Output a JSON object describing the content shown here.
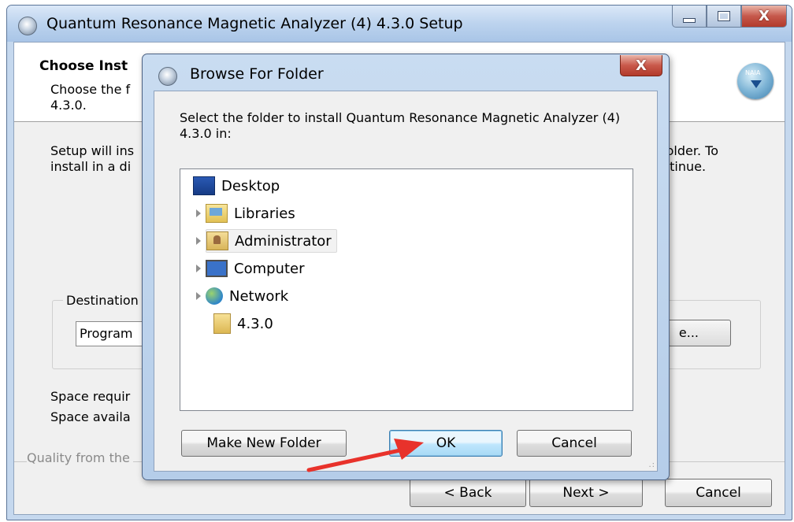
{
  "setup_window": {
    "title": "Quantum Resonance Magnetic Analyzer (4) 4.3.0 Setup",
    "min_glyph": "",
    "close_glyph": "X",
    "header_title": "Choose Inst",
    "header_subtitle": "Choose the f\n4.3.0.",
    "logo_tag": "NAIA",
    "intro_left": "Setup will ins\ninstall in a di",
    "intro_right": "folder. To\nntinue.",
    "destination_label": "Destination",
    "destination_value": "Program",
    "browse_button": "e...",
    "space_required": "Space requir",
    "space_available": "Space availa",
    "branding": "Quality from the",
    "back_button": "< Back",
    "next_button": "Next >",
    "cancel_button": "Cancel"
  },
  "browse_dialog": {
    "title": "Browse For Folder",
    "close_glyph": "X",
    "instruction": "Select the folder to install Quantum Resonance Magnetic Analyzer (4) 4.3.0 in:",
    "tree": [
      {
        "label": "Desktop",
        "icon": "desktop-icon",
        "expandable": false
      },
      {
        "label": "Libraries",
        "icon": "libraries-icon",
        "expandable": true
      },
      {
        "label": "Administrator",
        "icon": "user-folder-icon",
        "expandable": true,
        "selected": true
      },
      {
        "label": "Computer",
        "icon": "computer-icon",
        "expandable": true
      },
      {
        "label": "Network",
        "icon": "network-icon",
        "expandable": true
      },
      {
        "label": "4.3.0",
        "icon": "folder-icon",
        "expandable": false
      }
    ],
    "make_new_folder_button": "Make New Folder",
    "ok_button": "OK",
    "cancel_button": "Cancel"
  },
  "annotation": {
    "arrow_color": "#e8322b"
  },
  "colors": {
    "title_bar": "#bcd3ee",
    "close_red": "#c9594b",
    "ok_highlight": "#bee6fd"
  }
}
